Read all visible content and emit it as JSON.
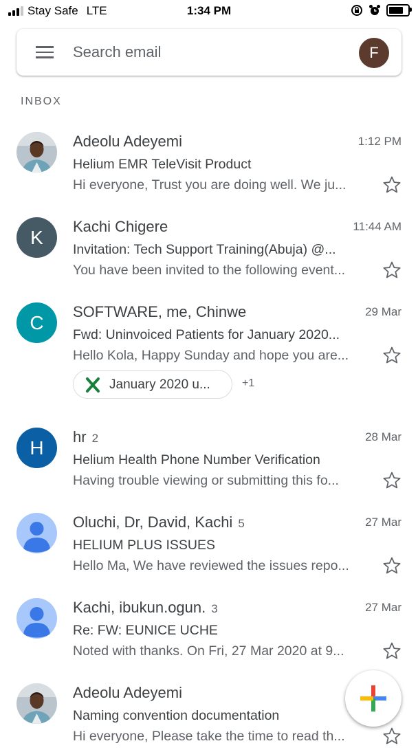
{
  "status_bar": {
    "carrier": "Stay Safe",
    "network": "LTE",
    "time": "1:34 PM",
    "battery_level": 0.9
  },
  "search": {
    "placeholder": "Search email",
    "account_initial": "F",
    "account_color": "#5d3a2e"
  },
  "inbox": {
    "label": "INBOX",
    "emails": [
      {
        "sender": "Adeolu Adeyemi",
        "count": "",
        "date": "1:12 PM",
        "subject": "Helium EMR TeleVisit Product",
        "snippet": "Hi everyone, Trust you are doing well. We ju...",
        "avatar": "photo",
        "starred": false
      },
      {
        "sender": "Kachi Chigere",
        "count": "",
        "date": "11:44 AM",
        "subject": "Invitation: Tech Support Training(Abuja) @...",
        "snippet": "You have been invited to the following event...",
        "avatar": "K",
        "avatar_color": "#455a64",
        "starred": false
      },
      {
        "sender": "SOFTWARE, me, Chinwe",
        "count": "",
        "date": "29 Mar",
        "subject": "Fwd: Uninvoiced Patients for January 2020...",
        "snippet": "Hello Kola, Happy Sunday and hope you are...",
        "avatar": "C",
        "avatar_color": "#0097a7",
        "starred": false,
        "attachment": {
          "name": "January 2020 u...",
          "icon": "excel-icon",
          "more": "+1"
        }
      },
      {
        "sender": "hr",
        "count": "2",
        "date": "28 Mar",
        "subject": "Helium Health Phone Number Verification",
        "snippet": "Having trouble viewing or submitting this fo...",
        "avatar": "H",
        "avatar_color": "#0b5fa5",
        "starred": false
      },
      {
        "sender": "Oluchi, Dr, David, Kachi",
        "count": "5",
        "date": "27 Mar",
        "subject": "HELIUM PLUS ISSUES",
        "snippet": "Hello Ma, We have reviewed the issues repo...",
        "avatar": "person",
        "avatar_color": "#a8c7fa",
        "starred": false
      },
      {
        "sender": "Kachi, ibukun.ogun.",
        "count": "3",
        "date": "27 Mar",
        "subject": "Re: FW: EUNICE UCHE",
        "snippet": "Noted with thanks. On Fri, 27 Mar 2020 at 9...",
        "avatar": "person",
        "avatar_color": "#a8c7fa",
        "starred": false
      },
      {
        "sender": "Adeolu Adeyemi",
        "count": "",
        "date": "",
        "subject": "Naming convention documentation",
        "snippet": "Hi everyone, Please take the time to read th...",
        "avatar": "photo",
        "starred": false
      }
    ]
  },
  "compose": {
    "icon": "plus-icon",
    "colors": [
      "#ea4335",
      "#fbbc04",
      "#34a853",
      "#4285f4"
    ]
  }
}
